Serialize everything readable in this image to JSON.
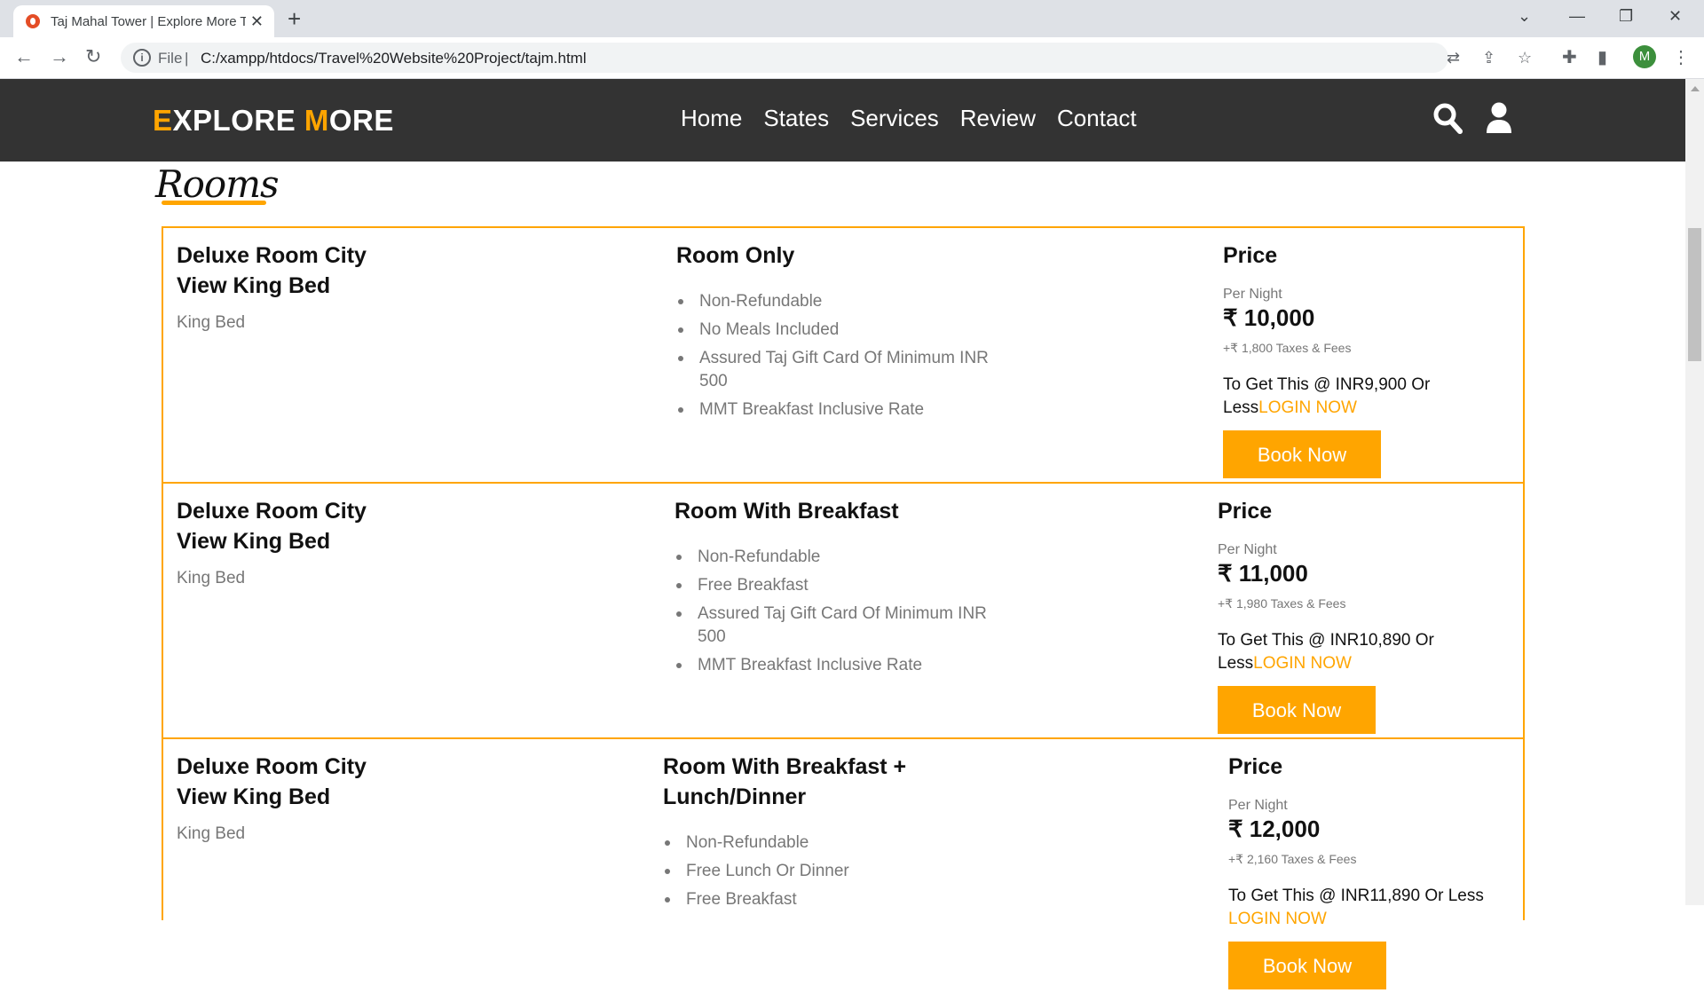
{
  "browser": {
    "tab_title": "Taj Mahal Tower | Explore More T",
    "omnibox_file": "File",
    "url": "C:/xampp/htdocs/Travel%20Website%20Project/tajm.html",
    "avatar_letter": "M"
  },
  "header": {
    "logo_first_initial": "E",
    "logo_first_rest": "XPLORE ",
    "logo_second_initial": "M",
    "logo_second_rest": "ORE",
    "nav": [
      "Home",
      "States",
      "Services",
      "Review",
      "Contact"
    ],
    "accent_color": "#ffa500"
  },
  "section_title": "Rooms",
  "rooms": [
    {
      "name": "Deluxe Room City View King Bed",
      "bed": "King Bed",
      "plan": "Room Only",
      "features": [
        "Non-Refundable",
        "No Meals Included",
        "Assured Taj Gift Card Of Minimum INR 500",
        "MMT Breakfast Inclusive Rate"
      ],
      "price_heading": "Price",
      "per_night": "Per Night",
      "amount": "₹ 10,000",
      "taxes": "+₹ 1,800 Taxes & Fees",
      "get_this": "To Get This @ INR9,900 Or Less",
      "login": "LOGIN NOW",
      "book": "Book Now"
    },
    {
      "name": "Deluxe Room City View King Bed",
      "bed": "King Bed",
      "plan": "Room With Breakfast",
      "features": [
        "Non-Refundable",
        "Free Breakfast",
        "Assured Taj Gift Card Of Minimum INR 500",
        "MMT Breakfast Inclusive Rate"
      ],
      "price_heading": "Price",
      "per_night": "Per Night",
      "amount": "₹ 11,000",
      "taxes": "+₹ 1,980 Taxes & Fees",
      "get_this": "To Get This @ INR10,890 Or Less",
      "login": "LOGIN NOW",
      "book": "Book Now"
    },
    {
      "name": "Deluxe Room City View King Bed",
      "bed": "King Bed",
      "plan": "Room With Breakfast + Lunch/Dinner",
      "features": [
        "Non-Refundable",
        "Free Lunch Or Dinner",
        "Free Breakfast"
      ],
      "price_heading": "Price",
      "per_night": "Per Night",
      "amount": "₹ 12,000",
      "taxes": "+₹ 2,160 Taxes & Fees",
      "get_this": "To Get This @ INR11,890 Or Less",
      "login": "LOGIN NOW",
      "book": "Book Now"
    }
  ]
}
